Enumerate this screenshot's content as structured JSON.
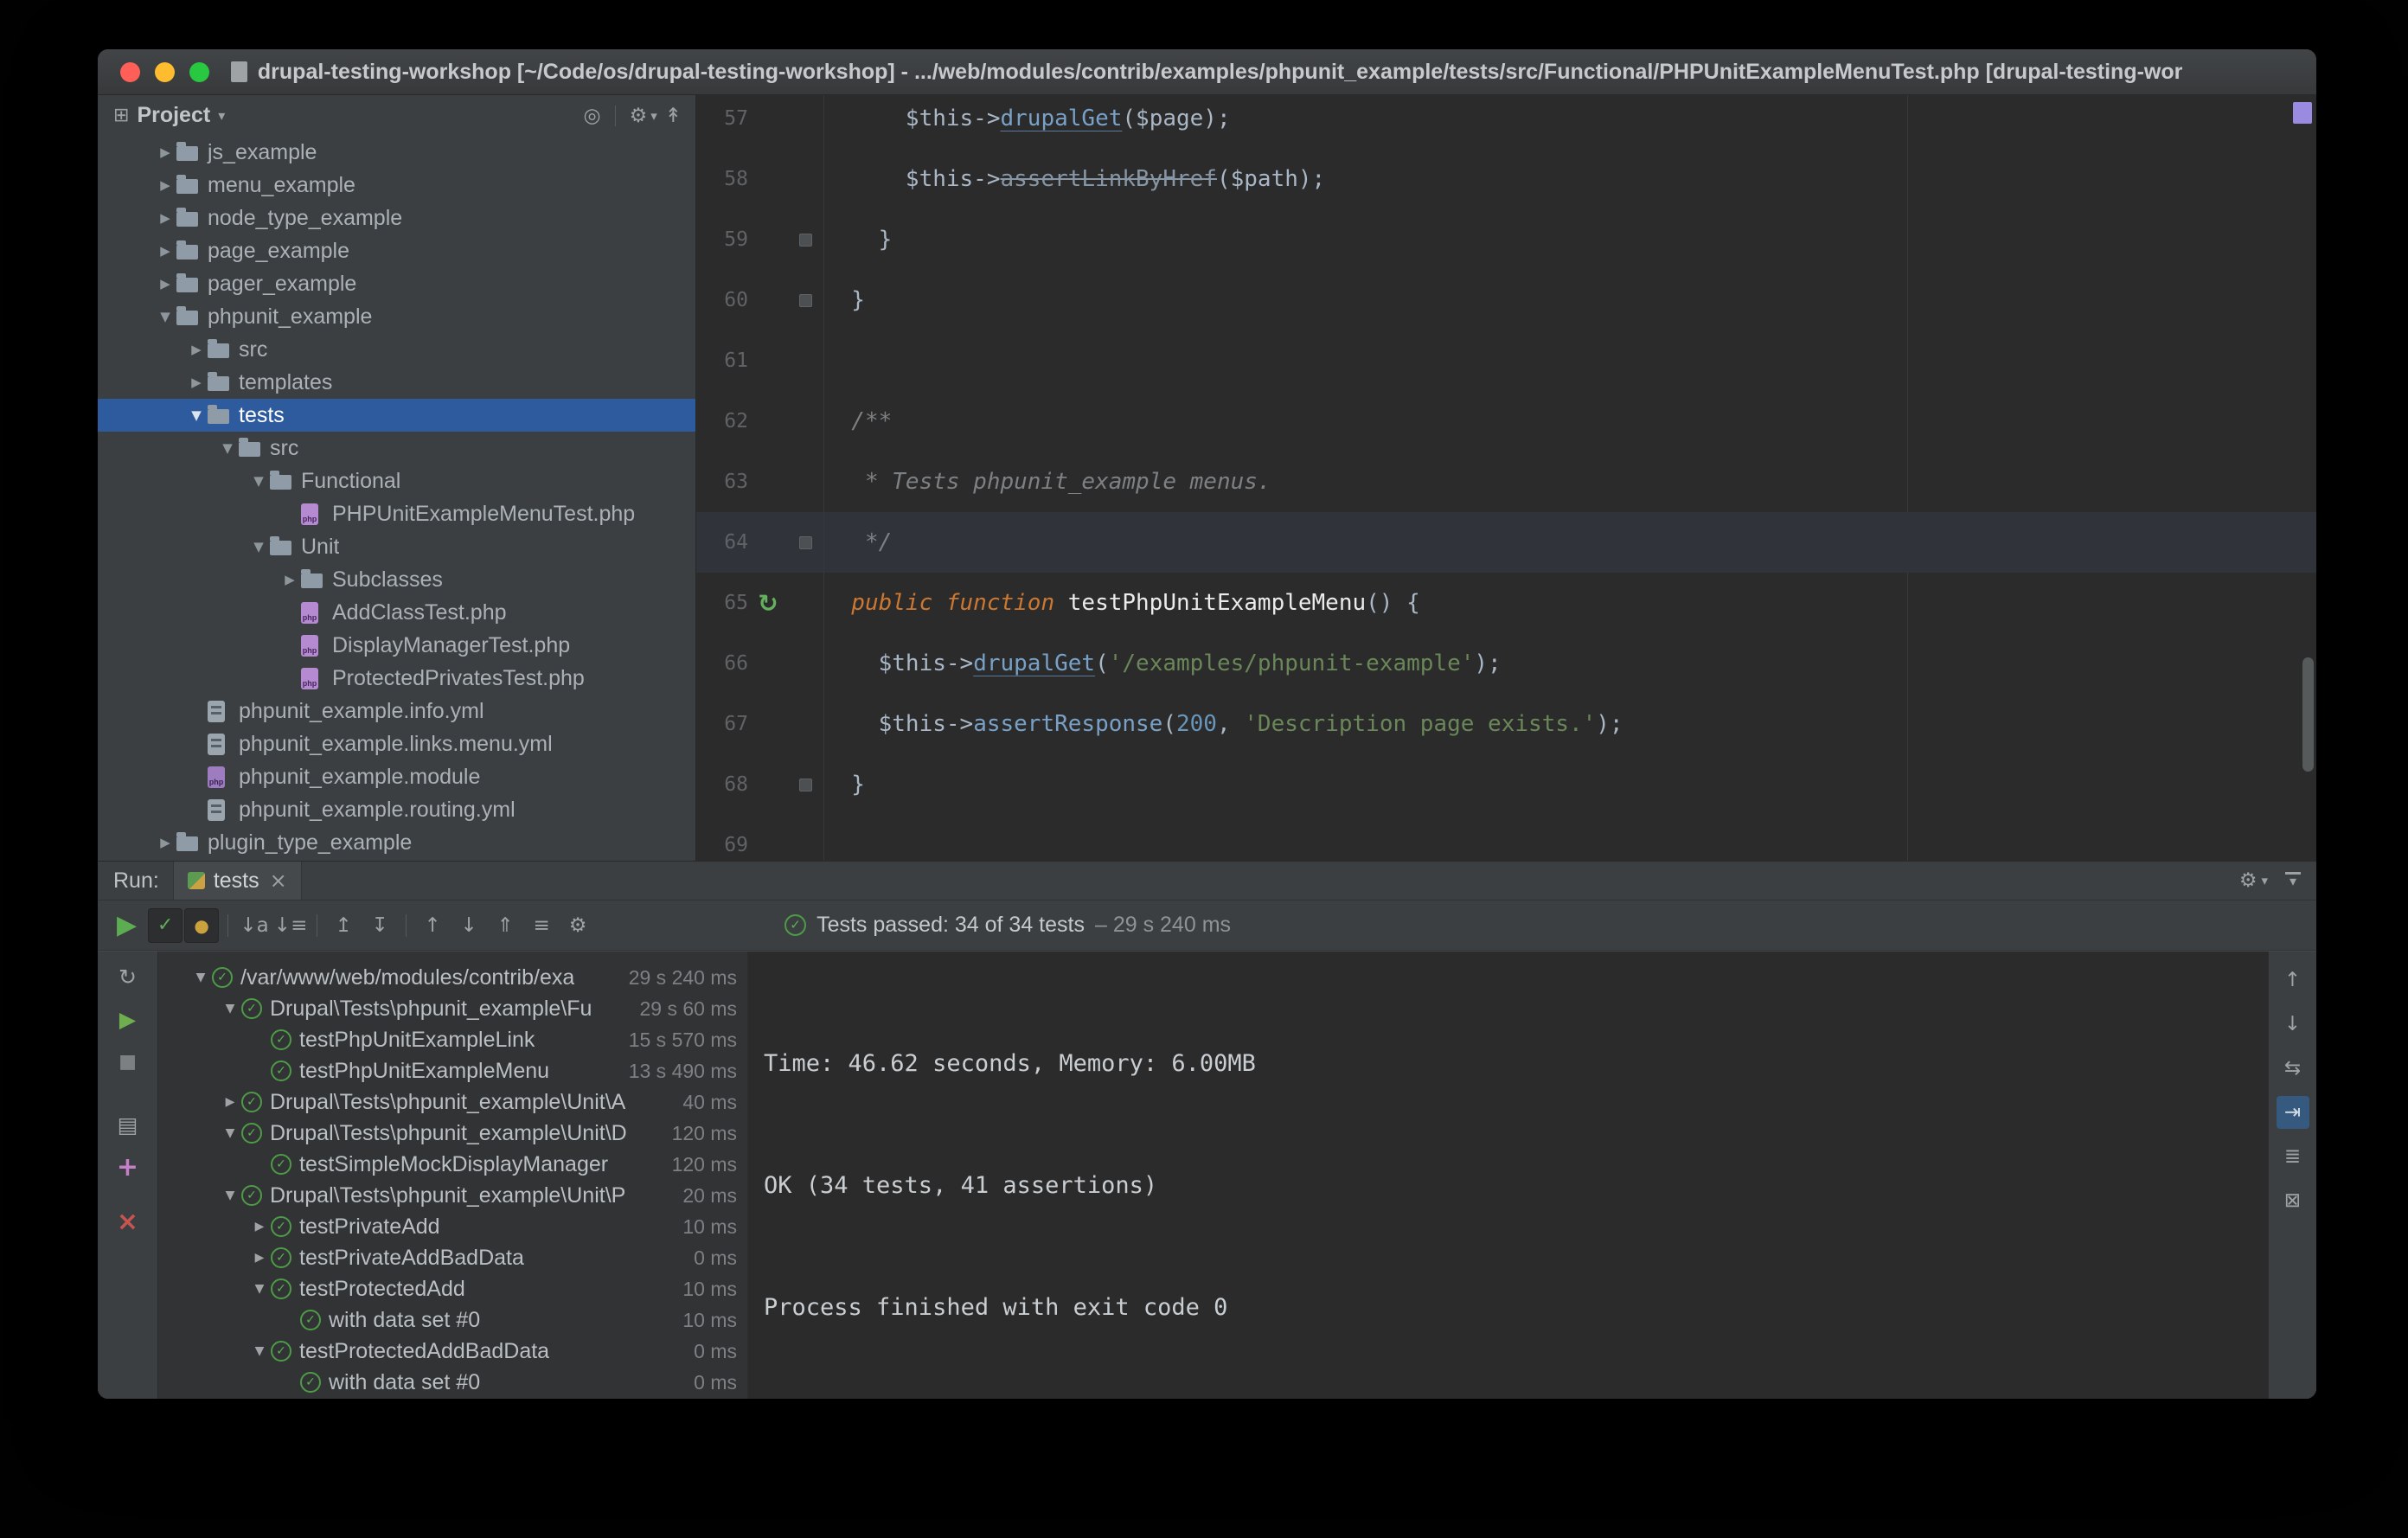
{
  "window": {
    "title": "drupal-testing-workshop [~/Code/os/drupal-testing-workshop] - .../web/modules/contrib/examples/phpunit_example/tests/src/Functional/PHPUnitExampleMenuTest.php [drupal-testing-workshop]"
  },
  "colors": {
    "selection_blue": "#2d5b9e",
    "test_passed_green": "#4e9b47",
    "error_stripe_purple": "#9b8be0",
    "keyword_orange": "#cc7832",
    "string_green": "#6a8759"
  },
  "icons": {
    "project_tool": "⊞",
    "caret_down": "▾",
    "locate": "◎",
    "gear": "⚙",
    "collapse_all": "↟",
    "expanded": "▼",
    "collapsed": "▶",
    "rerun": "↻",
    "check": "✓",
    "ignored": "●",
    "play": "▶",
    "close": "×",
    "sort_alpha": "↓a",
    "sort_duration": "↓≡",
    "expand_all": "↥",
    "collapse_all_tree": "↧",
    "arrow_up": "↑",
    "arrow_down": "↓",
    "import": "⇑",
    "history": "≡",
    "stop": "■",
    "console_tool": "▤",
    "attach": "+",
    "soft_wrap": "⇆",
    "scroll_end": "⇥",
    "print": "≣",
    "clear": "⊠"
  },
  "project_panel": {
    "header_title": "Project",
    "tree": [
      {
        "label": "js_example",
        "depth": 1,
        "arrow": "closed",
        "icon": "folder",
        "selected": false
      },
      {
        "label": "menu_example",
        "depth": 1,
        "arrow": "closed",
        "icon": "folder",
        "selected": false
      },
      {
        "label": "node_type_example",
        "depth": 1,
        "arrow": "closed",
        "icon": "folder",
        "selected": false
      },
      {
        "label": "page_example",
        "depth": 1,
        "arrow": "closed",
        "icon": "folder",
        "selected": false
      },
      {
        "label": "pager_example",
        "depth": 1,
        "arrow": "closed",
        "icon": "folder",
        "selected": false
      },
      {
        "label": "phpunit_example",
        "depth": 1,
        "arrow": "open",
        "icon": "folder",
        "selected": false
      },
      {
        "label": "src",
        "depth": 2,
        "arrow": "closed",
        "icon": "folder",
        "selected": false
      },
      {
        "label": "templates",
        "depth": 2,
        "arrow": "closed",
        "icon": "folder",
        "selected": false
      },
      {
        "label": "tests",
        "depth": 2,
        "arrow": "open",
        "icon": "folder",
        "selected": true
      },
      {
        "label": "src",
        "depth": 3,
        "arrow": "open",
        "icon": "folder",
        "selected": false
      },
      {
        "label": "Functional",
        "depth": 4,
        "arrow": "open",
        "icon": "folder",
        "selected": false
      },
      {
        "label": "PHPUnitExampleMenuTest.php",
        "depth": 5,
        "arrow": null,
        "icon": "php",
        "selected": false
      },
      {
        "label": "Unit",
        "depth": 4,
        "arrow": "open",
        "icon": "folder",
        "selected": false
      },
      {
        "label": "Subclasses",
        "depth": 5,
        "arrow": "closed",
        "icon": "folder",
        "selected": false
      },
      {
        "label": "AddClassTest.php",
        "depth": 5,
        "arrow": null,
        "icon": "php",
        "selected": false
      },
      {
        "label": "DisplayManagerTest.php",
        "depth": 5,
        "arrow": null,
        "icon": "php",
        "selected": false
      },
      {
        "label": "ProtectedPrivatesTest.php",
        "depth": 5,
        "arrow": null,
        "icon": "php",
        "selected": false
      },
      {
        "label": "phpunit_example.info.yml",
        "depth": 2,
        "arrow": null,
        "icon": "yml",
        "selected": false
      },
      {
        "label": "phpunit_example.links.menu.yml",
        "depth": 2,
        "arrow": null,
        "icon": "yml",
        "selected": false
      },
      {
        "label": "phpunit_example.module",
        "depth": 2,
        "arrow": null,
        "icon": "module",
        "selected": false
      },
      {
        "label": "phpunit_example.routing.yml",
        "depth": 2,
        "arrow": null,
        "icon": "yml",
        "selected": false
      },
      {
        "label": "plugin_type_example",
        "depth": 1,
        "arrow": "closed",
        "icon": "folder",
        "selected": false
      }
    ]
  },
  "editor": {
    "lines": [
      {
        "num": "57",
        "tokens": [
          [
            "p",
            "      $this->"
          ],
          [
            "m",
            "drupalGet"
          ],
          [
            "p",
            "($page);"
          ]
        ]
      },
      {
        "num": "58",
        "tokens": [
          [
            "p",
            "      $this->"
          ],
          [
            "dep",
            "assertLinkByHref"
          ],
          [
            "p",
            "($path);"
          ]
        ]
      },
      {
        "num": "59",
        "tokens": [
          [
            "p",
            "    }"
          ]
        ],
        "mark": true
      },
      {
        "num": "60",
        "tokens": [
          [
            "p",
            "  }"
          ]
        ],
        "mark": true
      },
      {
        "num": "61",
        "tokens": []
      },
      {
        "num": "62",
        "tokens": [
          [
            "c",
            "  /**"
          ]
        ]
      },
      {
        "num": "63",
        "tokens": [
          [
            "c",
            "   * Tests phpunit_example menus."
          ]
        ]
      },
      {
        "num": "64",
        "tokens": [
          [
            "c",
            "   */"
          ]
        ],
        "mark": true,
        "caret": true
      },
      {
        "num": "65",
        "tokens": [
          [
            "kw",
            "  public function "
          ],
          [
            "fn",
            "testPhpUnitExampleMenu"
          ],
          [
            "p",
            "() {"
          ]
        ],
        "run": true
      },
      {
        "num": "66",
        "tokens": [
          [
            "p",
            "    $this->"
          ],
          [
            "m",
            "drupalGet"
          ],
          [
            "p",
            "("
          ],
          [
            "s",
            "'/examples/phpunit-example'"
          ],
          [
            "p",
            ");"
          ]
        ]
      },
      {
        "num": "67",
        "tokens": [
          [
            "p",
            "    $this->"
          ],
          [
            "warn",
            "assertResponse"
          ],
          [
            "p",
            "("
          ],
          [
            "n",
            "200"
          ],
          [
            "p",
            ", "
          ],
          [
            "s",
            "'Description page exists.'"
          ],
          [
            "p",
            ");"
          ]
        ],
        "mark": false
      },
      {
        "num": "68",
        "tokens": [
          [
            "p",
            "  }"
          ]
        ],
        "mark": true
      },
      {
        "num": "69",
        "tokens": []
      }
    ]
  },
  "run_panel": {
    "label": "Run:",
    "tab_label": "tests",
    "status_text": "Tests passed: 34 of 34 tests",
    "status_duration": "– 29 s 240 ms",
    "tree": [
      {
        "label": "/var/www/web/modules/contrib/exa",
        "depth": 0,
        "arrow": "open",
        "duration": "29 s 240 ms"
      },
      {
        "label": "Drupal\\Tests\\phpunit_example\\Fu",
        "depth": 1,
        "arrow": "open",
        "duration": "29 s 60 ms"
      },
      {
        "label": "testPhpUnitExampleLink",
        "depth": 2,
        "arrow": null,
        "duration": "15 s 570 ms"
      },
      {
        "label": "testPhpUnitExampleMenu",
        "depth": 2,
        "arrow": null,
        "duration": "13 s 490 ms"
      },
      {
        "label": "Drupal\\Tests\\phpunit_example\\Unit\\A",
        "depth": 1,
        "arrow": "closed",
        "duration": "40 ms"
      },
      {
        "label": "Drupal\\Tests\\phpunit_example\\Unit\\D",
        "depth": 1,
        "arrow": "open",
        "duration": "120 ms"
      },
      {
        "label": "testSimpleMockDisplayManager",
        "depth": 2,
        "arrow": null,
        "duration": "120 ms"
      },
      {
        "label": "Drupal\\Tests\\phpunit_example\\Unit\\P",
        "depth": 1,
        "arrow": "open",
        "duration": "20 ms"
      },
      {
        "label": "testPrivateAdd",
        "depth": 2,
        "arrow": "closed",
        "duration": "10 ms"
      },
      {
        "label": "testPrivateAddBadData",
        "depth": 2,
        "arrow": "closed",
        "duration": "0 ms"
      },
      {
        "label": "testProtectedAdd",
        "depth": 2,
        "arrow": "open",
        "duration": "10 ms"
      },
      {
        "label": "with data set #0",
        "depth": 3,
        "arrow": null,
        "duration": "10 ms"
      },
      {
        "label": "testProtectedAddBadData",
        "depth": 2,
        "arrow": "open",
        "duration": "0 ms"
      },
      {
        "label": "with data set #0",
        "depth": 3,
        "arrow": null,
        "duration": "0 ms"
      }
    ]
  },
  "console": {
    "lines": [
      "",
      "",
      "Time: 46.62 seconds, Memory: 6.00MB",
      "",
      "",
      "OK (34 tests, 41 assertions)",
      "",
      "",
      "Process finished with exit code 0"
    ]
  }
}
